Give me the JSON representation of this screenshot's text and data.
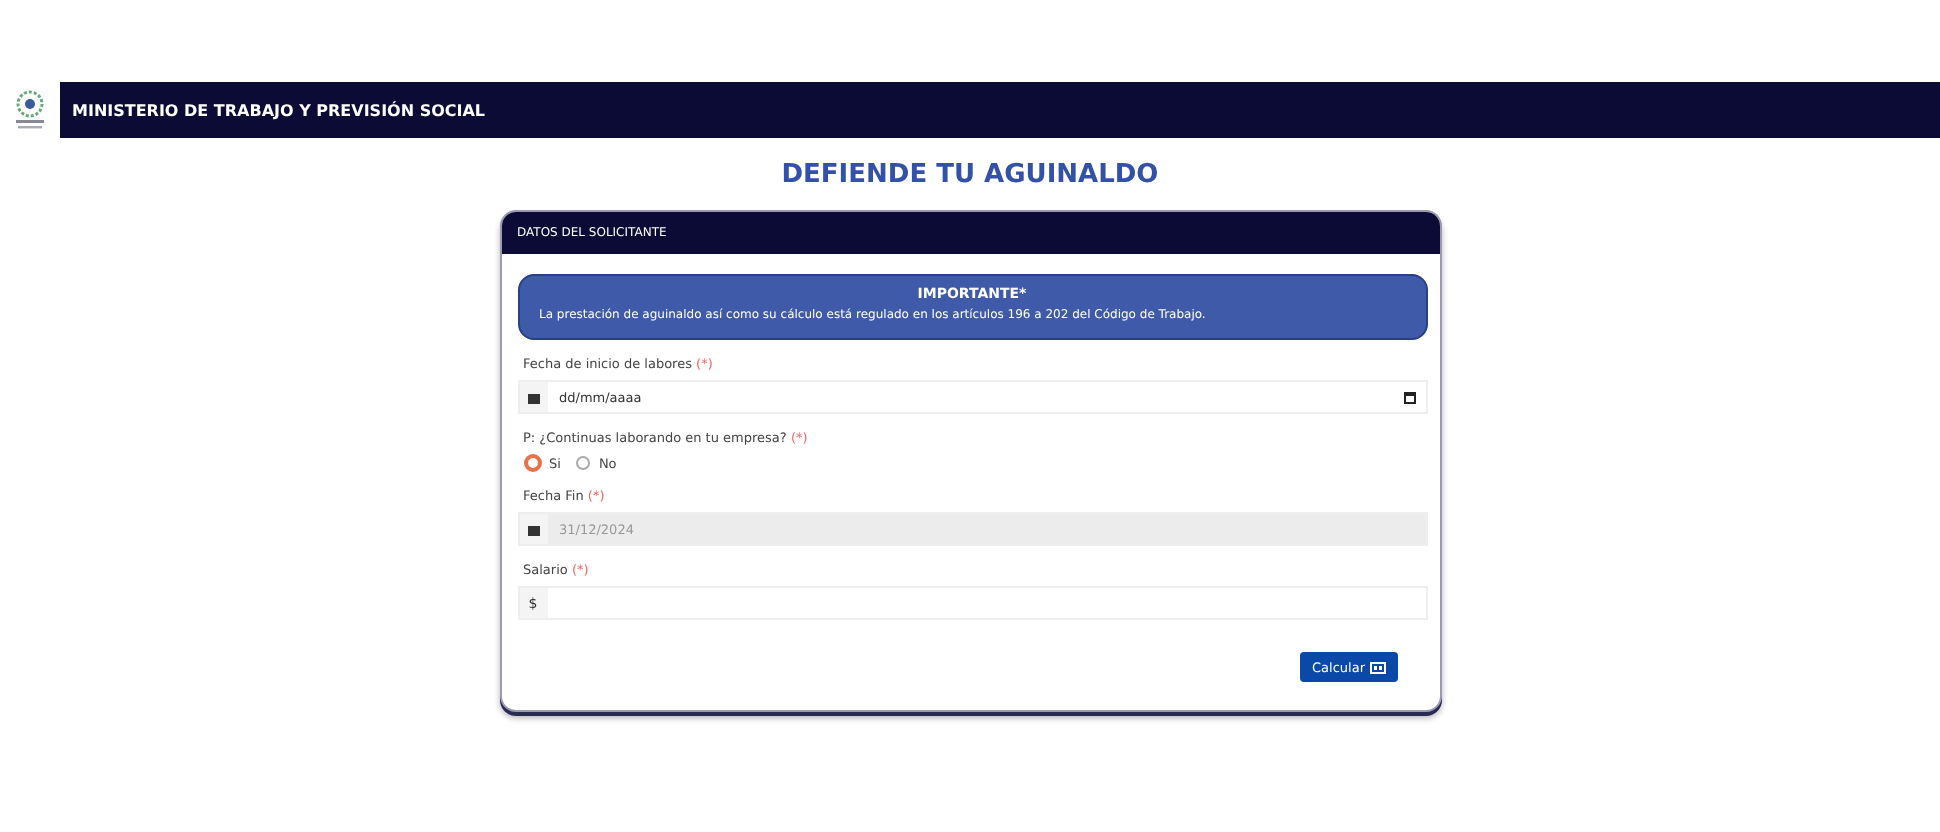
{
  "header": {
    "title": "MINISTERIO DE TRABAJO Y PREVISIÓN SOCIAL"
  },
  "page_title": "DEFIENDE TU AGUINALDO",
  "card": {
    "title": "DATOS DEL SOLICITANTE",
    "notice": {
      "title": "IMPORTANTE*",
      "text": "La prestación de aguinaldo así como su cálculo está regulado en los artículos 196 a 202 del Código de Trabajo."
    },
    "fields": [
      {
        "kind": "date",
        "label": "Fecha de inicio de labores",
        "required": "(*)",
        "placeholder": "dd/mm/aaaa",
        "disabled": false
      },
      {
        "kind": "radio",
        "label": "P: ¿Continuas laborando en tu empresa?",
        "required": "(*)",
        "options": [
          {
            "label": "Si",
            "selected": true
          },
          {
            "label": "No",
            "selected": false
          }
        ]
      },
      {
        "kind": "text",
        "label": "Fecha Fin",
        "required": "(*)",
        "value": "31/12/2024",
        "disabled": true
      },
      {
        "kind": "money",
        "label": "Salario",
        "required": "(*)",
        "prefix": "$",
        "disabled": false
      }
    ],
    "button": "Calcular"
  }
}
